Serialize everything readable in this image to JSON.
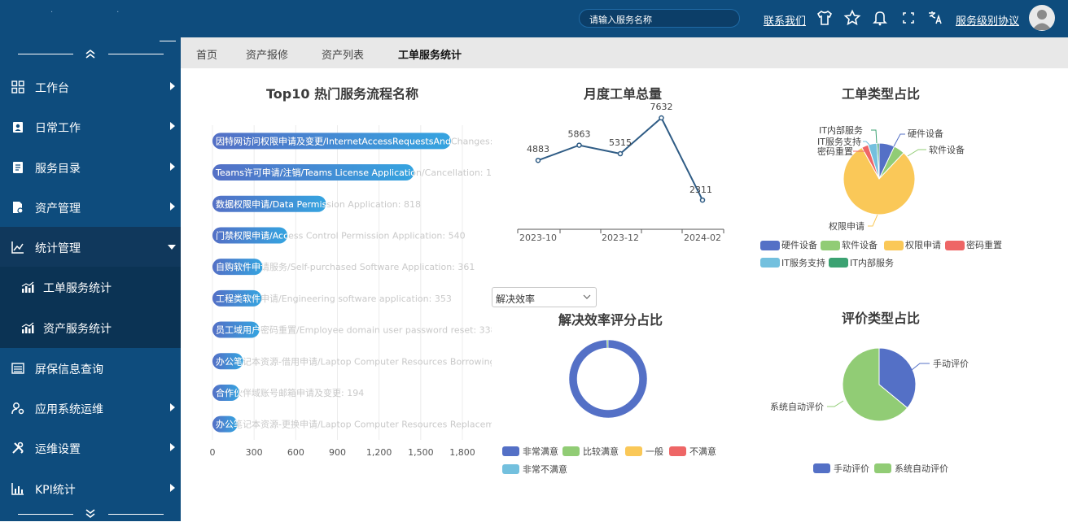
{
  "header": {
    "search_placeholder": "请输入服务名称",
    "contact_label": "联系我们",
    "sla_label": "服务级别协议",
    "icons": [
      "shirt-icon",
      "star-icon",
      "bell-icon",
      "fullscreen-icon",
      "translate-icon"
    ]
  },
  "sidebar": {
    "items": [
      {
        "label": "工作台",
        "icon": "grid-icon"
      },
      {
        "label": "日常工作",
        "icon": "badge-icon"
      },
      {
        "label": "服务目录",
        "icon": "catalog-icon"
      },
      {
        "label": "资产管理",
        "icon": "asset-icon"
      },
      {
        "label": "统计管理",
        "icon": "chart-line-icon"
      },
      {
        "label": "工单服务统计",
        "icon": "bar-chart-icon"
      },
      {
        "label": "资产服务统计",
        "icon": "bar-chart-icon"
      },
      {
        "label": "屏保信息查询",
        "icon": "list-icon"
      },
      {
        "label": "应用系统运维",
        "icon": "user-gear-icon"
      },
      {
        "label": "运维设置",
        "icon": "tools-icon"
      },
      {
        "label": "KPI统计",
        "icon": "kpi-icon"
      }
    ]
  },
  "tabs": [
    {
      "label": "首页"
    },
    {
      "label": "资产报修"
    },
    {
      "label": "资产列表"
    },
    {
      "label": "工单服务统计",
      "active": true
    }
  ],
  "filter": {
    "selected": "解决效率"
  },
  "colors": {
    "sidebar": "#0e4c7d",
    "blue": "#5470c6",
    "green": "#91cc75",
    "yellow": "#fac858",
    "red": "#ee6666",
    "lightblue": "#73c0de",
    "teal": "#3ba272",
    "line": "#2f5c85"
  },
  "chart_data": [
    {
      "type": "bar",
      "title": "Top10 热门服务流程名称",
      "orientation": "horizontal",
      "categories": [
        "因特网访问权限申请及变更/InternetAccessRequestsAndChanges",
        "Teams许可申请/注销/Teams License Application/Cancellation",
        "数据权限申请/Data Permission Application",
        "门禁权限申请/Access Control Permission Application",
        "自购软件申请服务/Self-purchased Software Application",
        "工程类软件申请/Engineering software application",
        "员工域用户密码重置/Employee domain user password reset",
        "办公笔记本资源-借用申请/Laptop Computer Resources Borrowing Application",
        "合作伙伴域账号邮箱申请及变更",
        "办公笔记本资源-更换申请/Laptop Computer Resources Replacement Application"
      ],
      "values": [
        1717,
        1451,
        818,
        540,
        361,
        353,
        338,
        220,
        194,
        180
      ],
      "labels": [
        "因特网访问权限申请及变更/InternetAccessRequestsAndChanges: 1717",
        "Teams许可申请/注销/Teams License Application/Cancellation: 1451",
        "数据权限申请/Data Permission Application: 818",
        "门禁权限申请/Access Control Permission Application: 540",
        "自购软件申请服务/Self-purchased Software Application: 361",
        "工程类软件申请/Engineering software application: 353",
        "员工域用户密码重置/Employee domain user password reset: 338",
        "办公笔记本资源-借用申请/Laptop Computer Resources Borrowing Appli",
        "合作伙伴域账号邮箱申请及变更: 194",
        "办公笔记本资源-更换申请/Laptop Computer Resources Replacement Ap"
      ],
      "xticks": [
        "0",
        "300",
        "600",
        "900",
        "1,200",
        "1,500",
        "1,800"
      ],
      "xlim": [
        0,
        1800
      ],
      "grid": true
    },
    {
      "type": "line",
      "title": "月度工单总量",
      "x": [
        "2023-10",
        "2023-11",
        "2023-12",
        "2024-01",
        "2024-02"
      ],
      "values": [
        4883,
        5863,
        5315,
        7632,
        2311
      ],
      "xticks": [
        "2023-10",
        "2023-12",
        "2024-02"
      ]
    },
    {
      "type": "pie",
      "title": "工单类型占比",
      "slices": [
        {
          "name": "硬件设备",
          "value": 7
        },
        {
          "name": "软件设备",
          "value": 5
        },
        {
          "name": "权限申请",
          "value": 80
        },
        {
          "name": "密码重置",
          "value": 3
        },
        {
          "name": "IT服务支持",
          "value": 4
        },
        {
          "name": "IT内部服务",
          "value": 1
        }
      ],
      "legend_position": "bottom"
    },
    {
      "type": "pie",
      "title": "解决效率评分占比",
      "style": "donut",
      "slices": [
        {
          "name": "非常满意",
          "value": 99.5
        },
        {
          "name": "比较满意",
          "value": 0.5
        },
        {
          "name": "一般",
          "value": 0
        },
        {
          "name": "不满意",
          "value": 0
        },
        {
          "name": "非常不满意",
          "value": 0
        }
      ],
      "legend_position": "bottom"
    },
    {
      "type": "pie",
      "title": "评价类型占比",
      "slices": [
        {
          "name": "手动评价",
          "value": 36
        },
        {
          "name": "系统自动评价",
          "value": 64
        }
      ],
      "legend_position": "bottom"
    }
  ]
}
